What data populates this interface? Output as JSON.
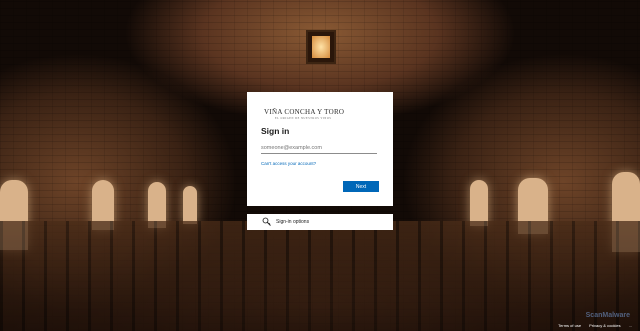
{
  "brand": {
    "logo_text": "VIÑA CONCHA Y TORO",
    "logo_subtext": "EL ORIGEN DE NUESTROS VINOS"
  },
  "signin": {
    "title": "Sign in",
    "email_placeholder": "someone@example.com",
    "cant_access_label": "Can't access your account?",
    "next_label": "Next"
  },
  "options": {
    "label": "Sign-in options",
    "icon": "key-search-icon"
  },
  "footer": {
    "terms_label": "Terms of use",
    "privacy_label": "Privacy & cookies",
    "more_label": "..."
  },
  "watermark": {
    "text": "ScanMalware"
  },
  "colors": {
    "accent": "#0067b8",
    "card_bg": "#ffffff"
  }
}
